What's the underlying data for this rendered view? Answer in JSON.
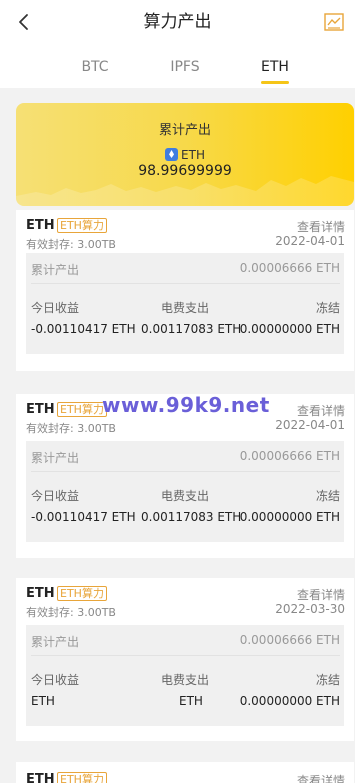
{
  "header": {
    "title": "算力产出"
  },
  "tabs": [
    {
      "label": "BTC"
    },
    {
      "label": "IPFS"
    },
    {
      "label": "ETH"
    }
  ],
  "banner": {
    "title": "累计产出",
    "coin": "ETH",
    "value": "98.99699999"
  },
  "cards": [
    {
      "coin": "ETH",
      "tag": "ETH算力",
      "details": "查看详情",
      "date": "2022-04-01",
      "storage": "有效封存: 3.00TB",
      "cumulative_label": "累计产出",
      "cumulative_value": "0.00006666 ETH",
      "labels": [
        "今日收益",
        "电费支出",
        "冻结"
      ],
      "values": [
        "-0.00110417 ETH",
        "0.00117083 ETH",
        "0.00000000 ETH"
      ]
    },
    {
      "coin": "ETH",
      "tag": "ETH算力",
      "details": "查看详情",
      "date": "2022-04-01",
      "storage": "有效封存: 3.00TB",
      "cumulative_label": "累计产出",
      "cumulative_value": "0.00006666 ETH",
      "labels": [
        "今日收益",
        "电费支出",
        "冻结"
      ],
      "values": [
        "-0.00110417 ETH",
        "0.00117083 ETH",
        "0.00000000 ETH"
      ]
    },
    {
      "coin": "ETH",
      "tag": "ETH算力",
      "details": "查看详情",
      "date": "2022-03-30",
      "storage": "有效封存: 3.00TB",
      "cumulative_label": "累计产出",
      "cumulative_value": "0.00006666 ETH",
      "labels": [
        "今日收益",
        "电费支出",
        "冻结"
      ],
      "values": [
        "ETH",
        "ETH",
        "0.00000000 ETH"
      ]
    },
    {
      "coin": "ETH",
      "tag": "ETH算力",
      "details": "查看详情"
    }
  ],
  "watermark": "www.99k9.net",
  "colors": {
    "accent": "#f5c518",
    "tag": "#e8a53a",
    "banner_start": "#f6e075",
    "banner_end": "#ffd000"
  },
  "icons": {
    "back": "chevron-left-icon",
    "chart": "line-chart-icon",
    "coin": "ethereum-icon"
  }
}
